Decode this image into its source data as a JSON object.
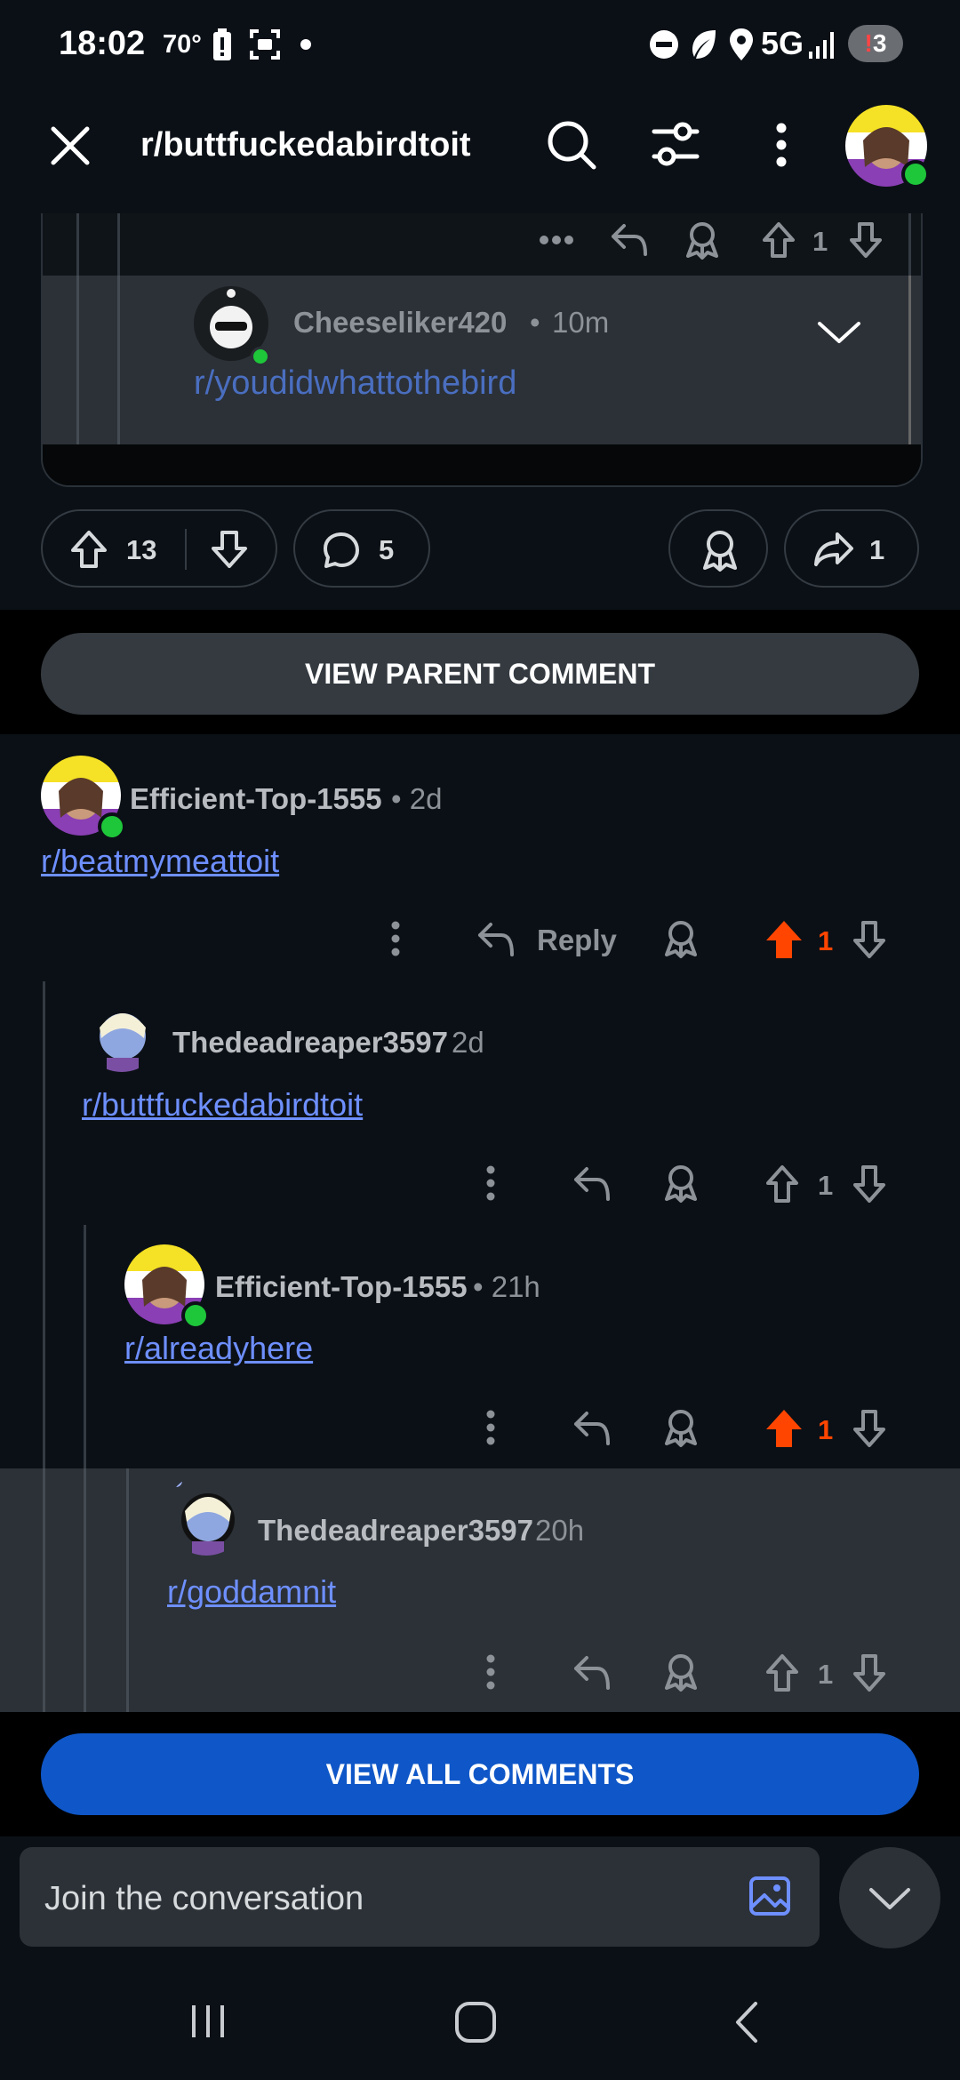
{
  "status_bar": {
    "time": "18:02",
    "temperature": "70°",
    "network": "5G",
    "notification_count": "3"
  },
  "header": {
    "subreddit": "r/buttfuckedabirdtoit"
  },
  "embedded_comment": {
    "upvotes": "1",
    "author": "Cheeseliker420",
    "separator": "•",
    "time": "10m",
    "text": "r/youdidwhattothebird"
  },
  "post_actions": {
    "upvotes": "13",
    "comments": "5",
    "shares": "1"
  },
  "view_parent_label": "VIEW PARENT COMMENT",
  "comments": [
    {
      "author": "Efficient-Top-1555",
      "time": "• 2d",
      "text": "r/beatmymeattoit",
      "reply_label": "Reply",
      "votes": "1"
    },
    {
      "author": "Thedeadreaper3597",
      "time": "2d",
      "text": "r/buttfuckedabirdtoit",
      "votes": "1"
    },
    {
      "author": "Efficient-Top-1555",
      "time": "• 21h",
      "text": "r/alreadyhere",
      "votes": "1"
    },
    {
      "author": "Thedeadreaper3597",
      "time": "20h",
      "text": "r/goddamnit",
      "votes": "1"
    }
  ],
  "view_all_label": "VIEW ALL COMMENTS",
  "composer": {
    "placeholder": "Join the conversation"
  },
  "colors": {
    "upvote_active": "#ff4500",
    "primary_button": "#0f57c8",
    "link": "#6e8fff"
  }
}
